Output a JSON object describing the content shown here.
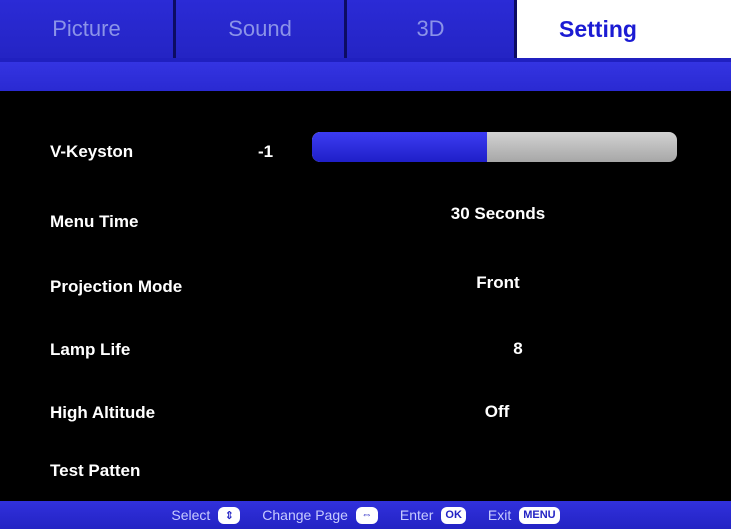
{
  "tabs": [
    {
      "label": "Picture"
    },
    {
      "label": "Sound"
    },
    {
      "label": "3D"
    },
    {
      "label": "Setting",
      "active": true
    }
  ],
  "rows": {
    "v_keyston": {
      "label": "V-Keyston",
      "value": "-1",
      "slider_fraction": 0.48
    },
    "menu_time": {
      "label": "Menu Time",
      "value": "30 Seconds"
    },
    "projection_mode": {
      "label": "Projection Mode",
      "value": "Front"
    },
    "lamp_life": {
      "label": "Lamp Life",
      "value": "8"
    },
    "high_altitude": {
      "label": "High Altitude",
      "value": "Off"
    },
    "test_patten": {
      "label": "Test Patten"
    }
  },
  "help": {
    "select": "Select",
    "select_key": "⇕",
    "change_page": "Change Page",
    "change_page_key": "⇔",
    "enter": "Enter",
    "enter_key": "OK",
    "exit": "Exit",
    "exit_key": "MENU"
  },
  "colors": {
    "menu_blue": "#2424c4",
    "active_tab_text": "#1b1bd3",
    "slider_fill": "#2a2ae0",
    "slider_track": "#b8b8b8"
  }
}
